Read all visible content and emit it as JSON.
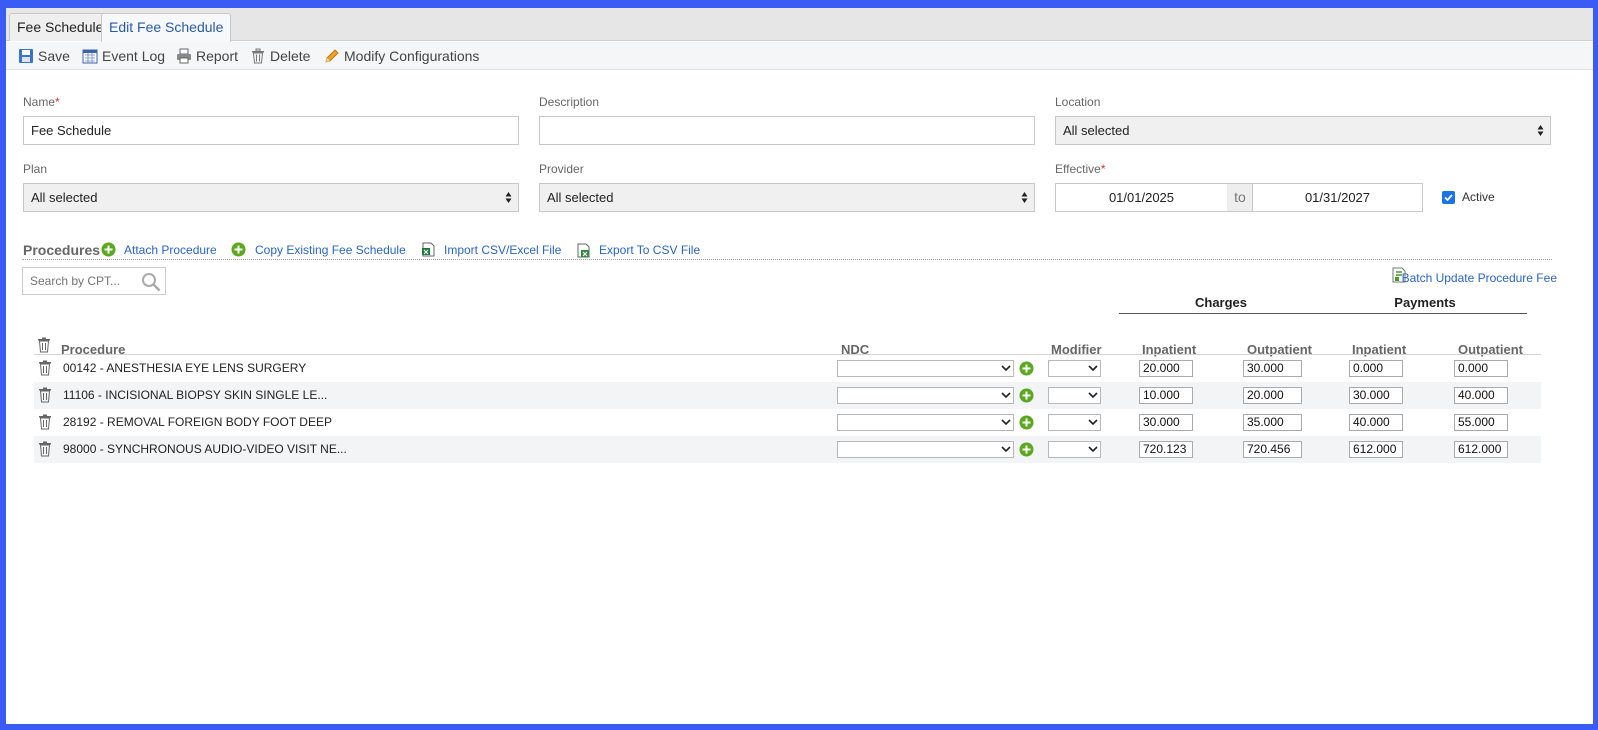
{
  "tabs": [
    {
      "label": "Fee Schedule"
    },
    {
      "label": "Edit Fee Schedule"
    }
  ],
  "toolbar": {
    "save": "Save",
    "event_log": "Event Log",
    "report": "Report",
    "delete": "Delete",
    "modify_configurations": "Modify Configurations"
  },
  "form": {
    "name": {
      "label": "Name",
      "required_mark": "*",
      "value": "Fee Schedule"
    },
    "description": {
      "label": "Description",
      "value": ""
    },
    "location": {
      "label": "Location",
      "value": "All selected"
    },
    "plan": {
      "label": "Plan",
      "value": "All selected"
    },
    "provider": {
      "label": "Provider",
      "value": "All selected"
    },
    "effective": {
      "label": "Effective",
      "required_mark": "*",
      "from": "01/01/2025",
      "to_label": "to",
      "to": "01/31/2027"
    },
    "active": {
      "label": "Active",
      "checked": true
    }
  },
  "procedures": {
    "title": "Procedures",
    "attach": "Attach Procedure",
    "copy": "Copy Existing Fee Schedule",
    "import": "Import CSV/Excel File",
    "export": "Export To CSV File",
    "search_placeholder": "Search by CPT...",
    "batch_update": "Batch Update Procedure Fee"
  },
  "table": {
    "group_headers": {
      "charges": "Charges",
      "payments": "Payments"
    },
    "columns": {
      "procedure": "Procedure",
      "ndc": "NDC",
      "modifier": "Modifier",
      "charges_inpatient": "Inpatient",
      "charges_outpatient": "Outpatient",
      "payments_inpatient": "Inpatient",
      "payments_outpatient": "Outpatient"
    },
    "rows": [
      {
        "procedure": "00142 - ANESTHESIA EYE LENS SURGERY",
        "ndc": "",
        "modifier": "",
        "charges_inpatient": "20.000",
        "charges_outpatient": "30.000",
        "payments_inpatient": "0.000",
        "payments_outpatient": "0.000"
      },
      {
        "procedure": "11106 - INCISIONAL BIOPSY SKIN SINGLE LE...",
        "ndc": "",
        "modifier": "",
        "charges_inpatient": "10.000",
        "charges_outpatient": "20.000",
        "payments_inpatient": "30.000",
        "payments_outpatient": "40.000"
      },
      {
        "procedure": "28192 - REMOVAL FOREIGN BODY FOOT DEEP",
        "ndc": "",
        "modifier": "",
        "charges_inpatient": "30.000",
        "charges_outpatient": "35.000",
        "payments_inpatient": "40.000",
        "payments_outpatient": "55.000"
      },
      {
        "procedure": "98000 - SYNCHRONOUS AUDIO-VIDEO VISIT NE...",
        "ndc": "",
        "modifier": "",
        "charges_inpatient": "720.123",
        "charges_outpatient": "720.456",
        "payments_inpatient": "612.000",
        "payments_outpatient": "612.000"
      }
    ]
  },
  "colors": {
    "frame_border": "#3a5cf5",
    "link": "#2a64c4",
    "required": "#dd3333",
    "checkbox": "#1a73e8",
    "add_icon": "#5aa81e"
  }
}
